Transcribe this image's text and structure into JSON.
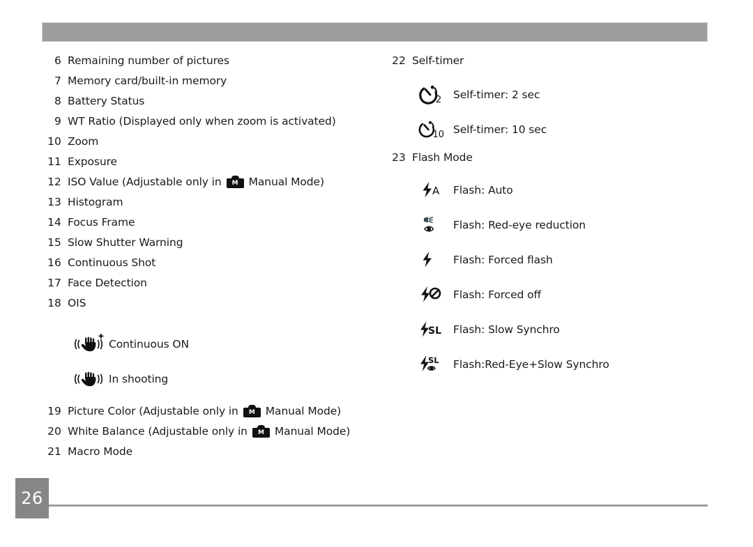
{
  "document": {
    "page_number": "26",
    "header_bar_color": "#9d9d9d",
    "page_number_box_color": "#868686",
    "footer_rule_color": "#9d9d9d"
  },
  "left_column": {
    "items": [
      {
        "num": "6",
        "label": "Remaining number of pictures"
      },
      {
        "num": "7",
        "label": "Memory card/built-in memory"
      },
      {
        "num": "8",
        "label": "Battery Status"
      },
      {
        "num": "9",
        "label": "WT Ratio (Displayed only when zoom is activated)"
      },
      {
        "num": "10",
        "label": "Zoom"
      },
      {
        "num": "11",
        "label": "Exposure"
      },
      {
        "num": "12",
        "label_before": "ISO Value (Adjustable only in",
        "icon": "manual-mode-camera-icon",
        "label_after": "Manual Mode)"
      },
      {
        "num": "13",
        "label": "Histogram"
      },
      {
        "num": "14",
        "label": "Focus Frame"
      },
      {
        "num": "15",
        "label": "Slow Shutter Warning"
      },
      {
        "num": "16",
        "label": "Continuous Shot"
      },
      {
        "num": "17",
        "label": "Face Detection"
      },
      {
        "num": "18",
        "label": "OIS"
      }
    ],
    "ois_modes": [
      {
        "icon": "ois-continuous-on-icon",
        "label": "Continuous ON"
      },
      {
        "icon": "ois-in-shooting-icon",
        "label": "In shooting"
      }
    ],
    "items_after_ois": [
      {
        "num": "19",
        "label_before": "Picture Color (Adjustable only in",
        "icon": "manual-mode-camera-icon",
        "label_after": "Manual Mode)"
      },
      {
        "num": "20",
        "label_before": "White Balance (Adjustable only in",
        "icon": "manual-mode-camera-icon",
        "label_after": "Manual Mode)"
      },
      {
        "num": "21",
        "label": "Macro Mode"
      }
    ]
  },
  "right_column": {
    "self_timer": {
      "num": "22",
      "label": "Self-timer",
      "modes": [
        {
          "icon": "self-timer-2sec-icon",
          "icon_text": "2",
          "label": "Self-timer: 2 sec"
        },
        {
          "icon": "self-timer-10sec-icon",
          "icon_text": "10",
          "label": "Self-timer: 10 sec"
        }
      ]
    },
    "flash_mode": {
      "num": "23",
      "label": "Flash Mode",
      "modes": [
        {
          "icon": "flash-auto-icon",
          "icon_text": "A",
          "label": "Flash: Auto"
        },
        {
          "icon": "flash-red-eye-reduction-icon",
          "icon_text": "",
          "label": "Flash: Red-eye reduction"
        },
        {
          "icon": "flash-forced-flash-icon",
          "icon_text": "",
          "label": "Flash: Forced flash"
        },
        {
          "icon": "flash-forced-off-icon",
          "icon_text": "",
          "label": "Flash: Forced off"
        },
        {
          "icon": "flash-slow-synchro-icon",
          "icon_text": "SL",
          "label": "Flash: Slow Synchro"
        },
        {
          "icon": "flash-red-eye-slow-synchro-icon",
          "icon_text": "SL",
          "label": "Flash:Red-Eye+Slow Synchro"
        }
      ]
    }
  }
}
